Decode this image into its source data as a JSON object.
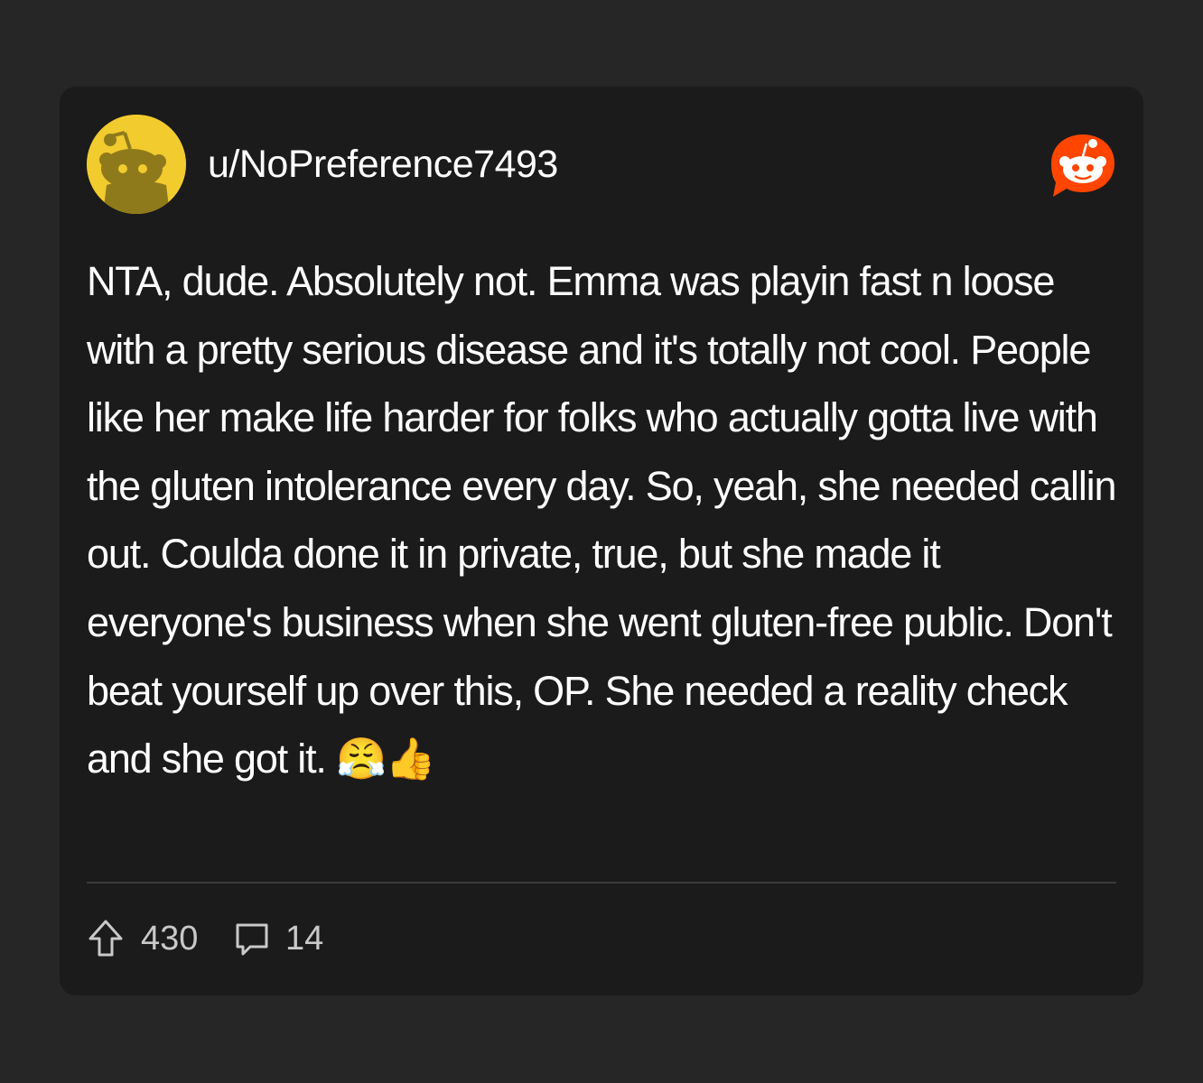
{
  "post": {
    "username": "u/NoPreference7493",
    "avatar_icon": "snoo-avatar",
    "avatar_color": "#f2cb2f",
    "brand_icon": "reddit-logo-icon",
    "brand_color": "#ff4500",
    "body": "NTA, dude. Absolutely not. Emma was playin fast n loose with a pretty serious disease and it's totally not cool. People like her make life harder for folks who actually gotta live with the gluten intolerance every day. So, yeah, she needed callin out. Coulda done it in private, true, but she made it everyone's business when she went gluten-free public. Don't beat yourself up over this, OP. She needed a reality check and she got it. 😤👍"
  },
  "footer": {
    "upvote_icon": "upvote-arrow-icon",
    "upvotes": "430",
    "comment_icon": "comment-bubble-icon",
    "comments": "14"
  }
}
